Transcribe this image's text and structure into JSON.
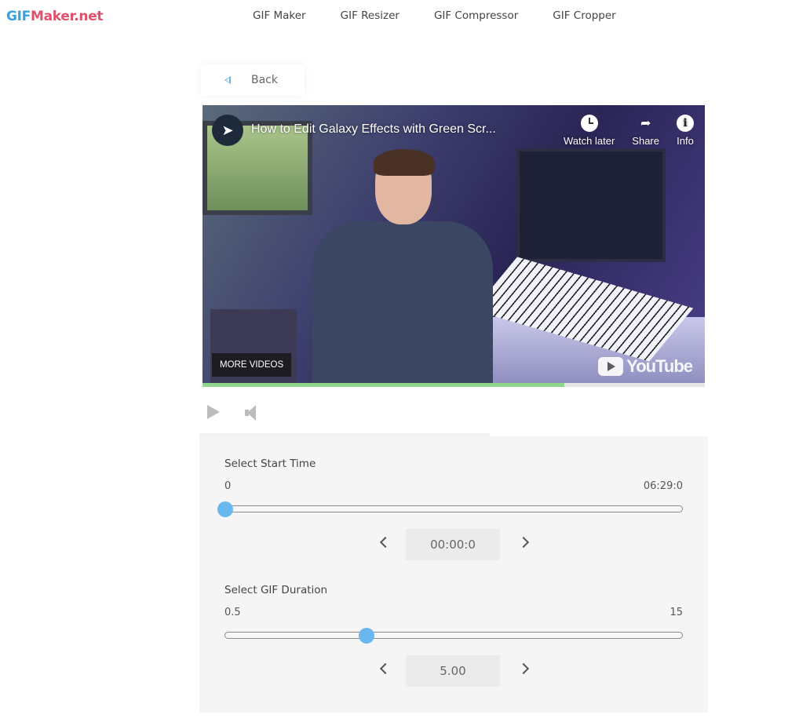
{
  "brand": {
    "part1": "GIF",
    "part2": "Maker.net"
  },
  "nav": [
    {
      "label": "GIF Maker"
    },
    {
      "label": "GIF Resizer"
    },
    {
      "label": "GIF Compressor"
    },
    {
      "label": "GIF Cropper"
    }
  ],
  "back": {
    "label": "Back"
  },
  "video": {
    "title": "How to Edit Galaxy Effects with Green Scr...",
    "channel_icon": "filmora-logo-icon",
    "actions": [
      {
        "label": "Watch later",
        "icon": "clock-icon"
      },
      {
        "label": "Share",
        "icon": "share-arrow-icon"
      },
      {
        "label": "Info",
        "icon": "info-icon"
      }
    ],
    "more_videos": "MORE VIDEOS",
    "yt_logo": "YouTube",
    "progress": 0.72
  },
  "player": {
    "play_icon": "play-icon",
    "volume_icon": "volume-icon"
  },
  "start_time": {
    "title": "Select Start Time",
    "min": "0",
    "max": "06:29:0",
    "value": "00:00:0",
    "position": 0.0
  },
  "duration": {
    "title": "Select GIF Duration",
    "min": "0.5",
    "max": "15",
    "value": "5.00",
    "position": 0.31
  },
  "colors": {
    "brand_blue": "#3aa0e0",
    "brand_red": "#e0506a",
    "slider_thumb": "#6ab6ef",
    "progress_green": "#8fd68a"
  }
}
